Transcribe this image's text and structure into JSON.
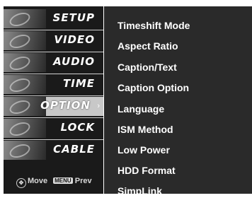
{
  "menu": {
    "tabs": [
      {
        "label": "SETUP"
      },
      {
        "label": "VIDEO"
      },
      {
        "label": "AUDIO"
      },
      {
        "label": "TIME"
      },
      {
        "label": "OPTION",
        "active": true
      },
      {
        "label": "LOCK"
      },
      {
        "label": "CABLE"
      }
    ],
    "active_tab_arrow": "›"
  },
  "options": {
    "items": [
      "Timeshift Mode",
      "Aspect Ratio",
      "Caption/Text",
      "Caption Option",
      "Language",
      "ISM Method",
      "Low Power",
      "HDD Format",
      "SimpLink"
    ]
  },
  "hints": {
    "move_icon": "move-icon",
    "move_label": "Move",
    "menu_key": "MENU",
    "prev_label": "Prev"
  }
}
